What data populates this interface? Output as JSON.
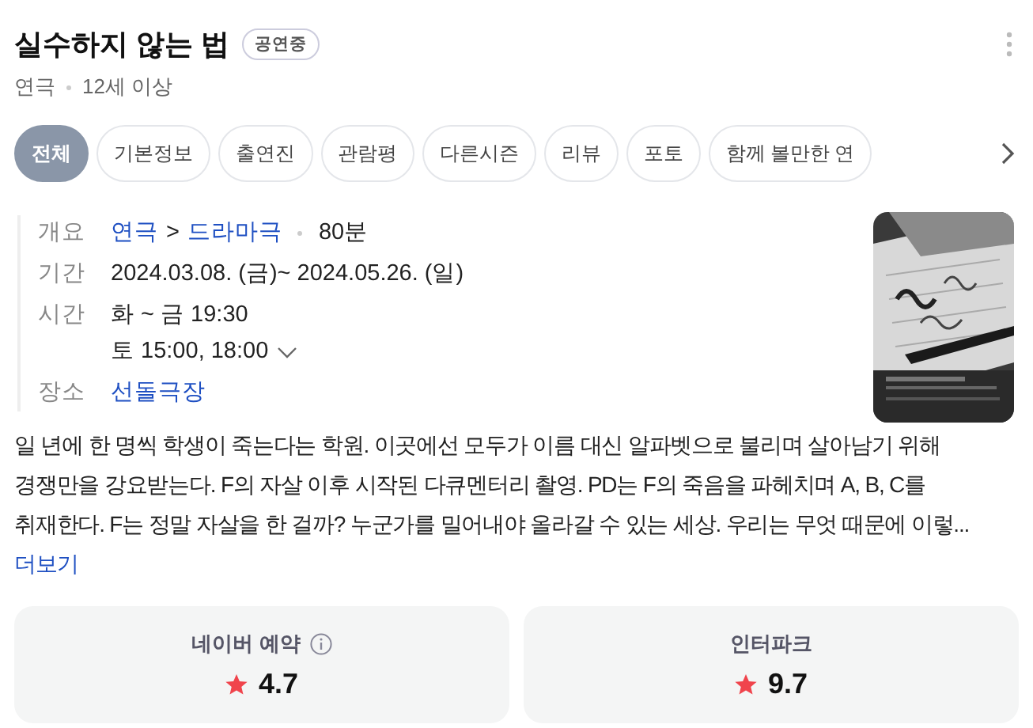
{
  "header": {
    "title": "실수하지 않는 법",
    "badge": "공연중",
    "meta": [
      "연극",
      "12세 이상"
    ]
  },
  "tabs": [
    {
      "label": "전체",
      "selected": true
    },
    {
      "label": "기본정보",
      "selected": false
    },
    {
      "label": "출연진",
      "selected": false
    },
    {
      "label": "관람평",
      "selected": false
    },
    {
      "label": "다른시즌",
      "selected": false
    },
    {
      "label": "리뷰",
      "selected": false
    },
    {
      "label": "포토",
      "selected": false
    },
    {
      "label": "함께 볼만한 연",
      "selected": false
    }
  ],
  "info": [
    {
      "label": "개요",
      "lines": [
        [
          {
            "kind": "link",
            "text": "연극"
          },
          {
            "kind": "text",
            "text": ">"
          },
          {
            "kind": "link",
            "text": "드라마극"
          },
          {
            "kind": "separator"
          },
          {
            "kind": "text",
            "text": "80분"
          }
        ]
      ]
    },
    {
      "label": "기간",
      "lines": [
        [
          {
            "kind": "text",
            "text": "2024.03.08. (금)~ 2024.05.26. (일)"
          }
        ]
      ]
    },
    {
      "label": "시간",
      "lines": [
        [
          {
            "kind": "text",
            "text": "화 ~ 금 19:30"
          }
        ],
        [
          {
            "kind": "text",
            "text": "토 15:00, 18:00"
          },
          {
            "kind": "expand"
          }
        ]
      ]
    },
    {
      "label": "장소",
      "lines": [
        [
          {
            "kind": "link",
            "text": "선돌극장"
          }
        ]
      ]
    }
  ],
  "description": {
    "text": "일 년에 한 명씩 학생이 죽는다는 학원. 이곳에선 모두가 이름 대신 알파벳으로 불리며 살아남기 위해 경쟁만을 강요받는다. F의 자살 이후 시작된 다큐멘터리 촬영. PD는 F의 죽음을 파헤치며 A, B, C를 취재한다. F는 정말 자살을 한 걸까? 누군가를 밀어내야 올라갈 수 있는 세상. 우리는 무엇 때문에 이렇...",
    "more": "더보기"
  },
  "ratings": [
    {
      "source": "네이버 예약",
      "info": true,
      "score": "4.7"
    },
    {
      "source": "인터파크",
      "info": false,
      "score": "9.7"
    }
  ]
}
